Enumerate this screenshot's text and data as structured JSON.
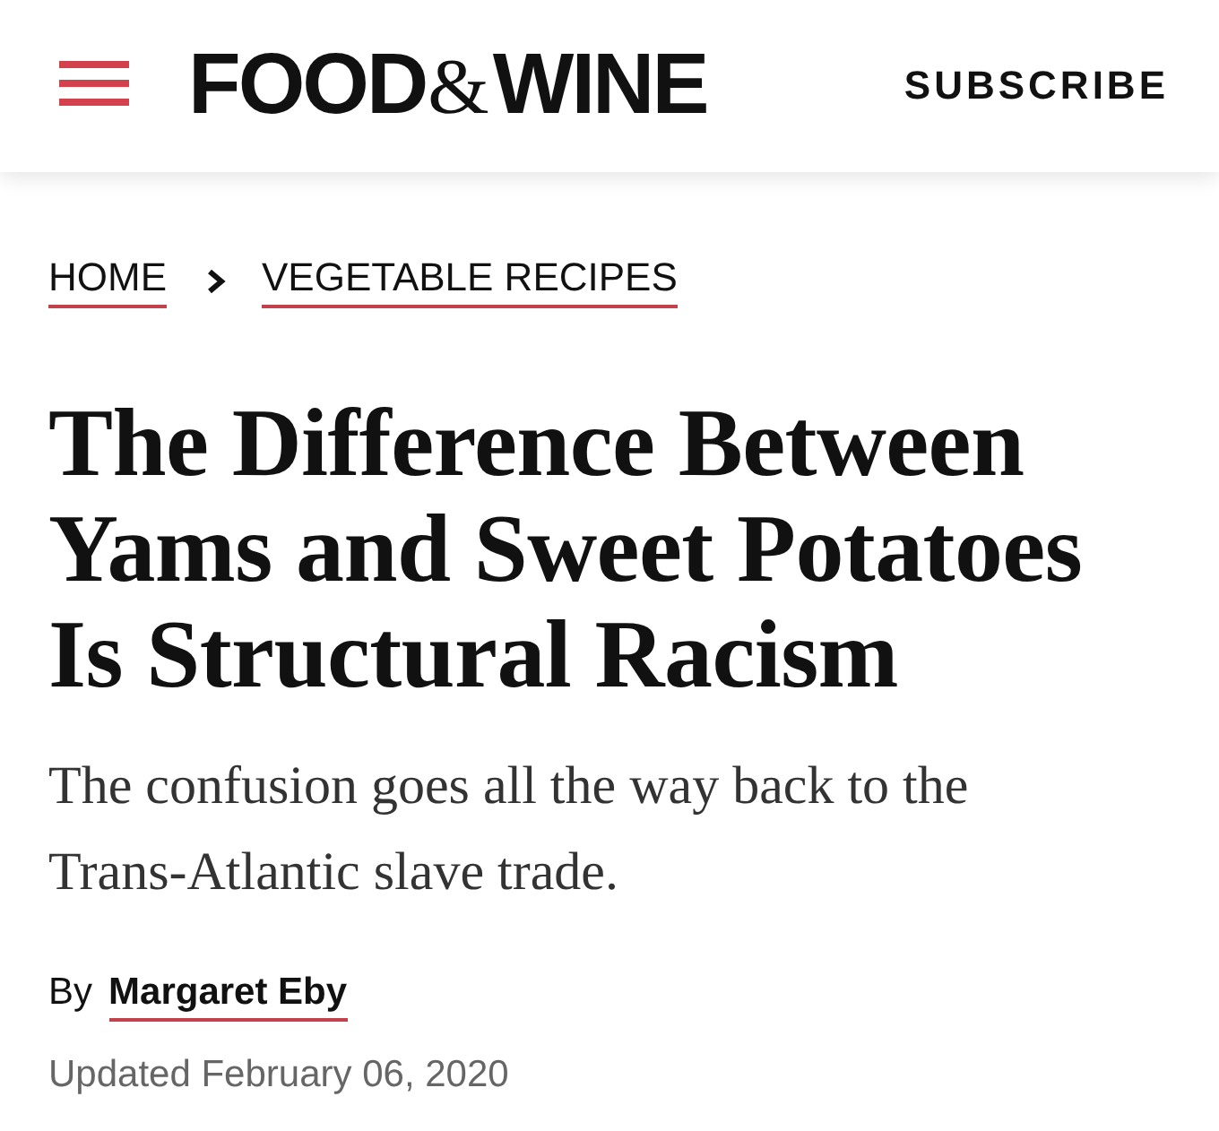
{
  "header": {
    "logo": [
      "FOOD",
      "&",
      "WINE"
    ],
    "subscribe": "SUBSCRIBE"
  },
  "breadcrumbs": [
    "HOME",
    "VEGETABLE RECIPES"
  ],
  "article": {
    "title": "The Difference Between Yams and Sweet Potatoes Is Structural Racism",
    "subtitle": "The confusion goes all the way back to the Trans-Atlantic slave trade.",
    "byline": {
      "prefix": "By",
      "author": "Margaret Eby"
    },
    "updated": "Updated February 06, 2020"
  }
}
